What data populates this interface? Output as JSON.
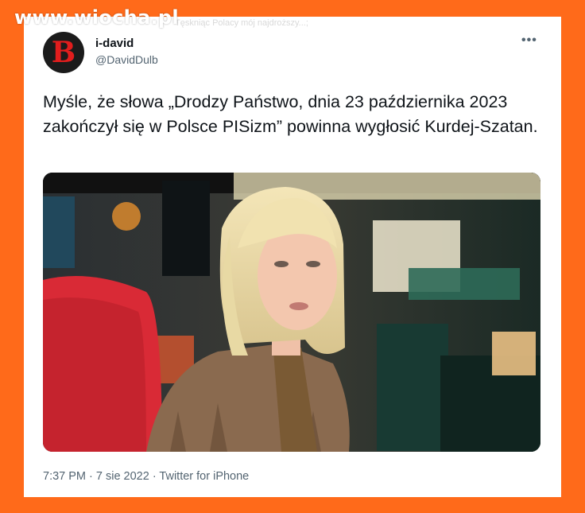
{
  "watermark": {
    "text": "www.wiocha.pl"
  },
  "faded_header": {
    "text": "Tęskniąc Polacy mój najdroższy...;"
  },
  "tweet": {
    "avatar_letter": "B",
    "display_name": "i-david",
    "handle": "@DavidDulb",
    "more_label": "•••",
    "text": "Myśle, że słowa „Drodzy Państwo, dnia 23 października 2023 zakończył się w Polsce PISizm” powinna wygłosić Kurdej-Szatan.",
    "timestamp": "7:37 PM · 7 sie 2022 · Twitter for iPhone",
    "media_icon": "photo-of-woman-in-tv-studio"
  },
  "colors": {
    "background": "#ff6a1a",
    "card": "#ffffff",
    "primary_text": "#0f1419",
    "secondary_text": "#536471",
    "avatar_bg": "#1b1b1b",
    "avatar_letter": "#e11d1d"
  }
}
